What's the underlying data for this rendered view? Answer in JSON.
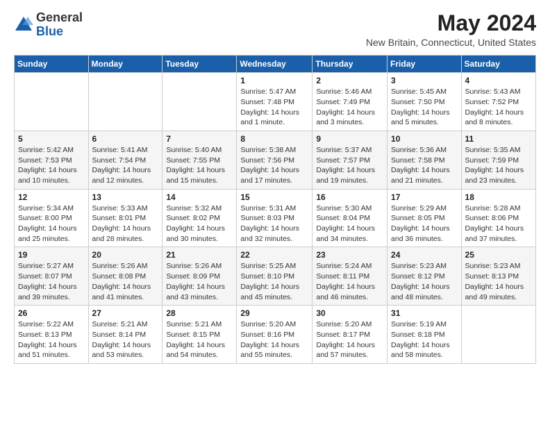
{
  "logo": {
    "general": "General",
    "blue": "Blue"
  },
  "title": {
    "month_year": "May 2024",
    "location": "New Britain, Connecticut, United States"
  },
  "weekdays": [
    "Sunday",
    "Monday",
    "Tuesday",
    "Wednesday",
    "Thursday",
    "Friday",
    "Saturday"
  ],
  "weeks": [
    [
      {
        "day": "",
        "info": ""
      },
      {
        "day": "",
        "info": ""
      },
      {
        "day": "",
        "info": ""
      },
      {
        "day": "1",
        "info": "Sunrise: 5:47 AM\nSunset: 7:48 PM\nDaylight: 14 hours\nand 1 minute."
      },
      {
        "day": "2",
        "info": "Sunrise: 5:46 AM\nSunset: 7:49 PM\nDaylight: 14 hours\nand 3 minutes."
      },
      {
        "day": "3",
        "info": "Sunrise: 5:45 AM\nSunset: 7:50 PM\nDaylight: 14 hours\nand 5 minutes."
      },
      {
        "day": "4",
        "info": "Sunrise: 5:43 AM\nSunset: 7:52 PM\nDaylight: 14 hours\nand 8 minutes."
      }
    ],
    [
      {
        "day": "5",
        "info": "Sunrise: 5:42 AM\nSunset: 7:53 PM\nDaylight: 14 hours\nand 10 minutes."
      },
      {
        "day": "6",
        "info": "Sunrise: 5:41 AM\nSunset: 7:54 PM\nDaylight: 14 hours\nand 12 minutes."
      },
      {
        "day": "7",
        "info": "Sunrise: 5:40 AM\nSunset: 7:55 PM\nDaylight: 14 hours\nand 15 minutes."
      },
      {
        "day": "8",
        "info": "Sunrise: 5:38 AM\nSunset: 7:56 PM\nDaylight: 14 hours\nand 17 minutes."
      },
      {
        "day": "9",
        "info": "Sunrise: 5:37 AM\nSunset: 7:57 PM\nDaylight: 14 hours\nand 19 minutes."
      },
      {
        "day": "10",
        "info": "Sunrise: 5:36 AM\nSunset: 7:58 PM\nDaylight: 14 hours\nand 21 minutes."
      },
      {
        "day": "11",
        "info": "Sunrise: 5:35 AM\nSunset: 7:59 PM\nDaylight: 14 hours\nand 23 minutes."
      }
    ],
    [
      {
        "day": "12",
        "info": "Sunrise: 5:34 AM\nSunset: 8:00 PM\nDaylight: 14 hours\nand 25 minutes."
      },
      {
        "day": "13",
        "info": "Sunrise: 5:33 AM\nSunset: 8:01 PM\nDaylight: 14 hours\nand 28 minutes."
      },
      {
        "day": "14",
        "info": "Sunrise: 5:32 AM\nSunset: 8:02 PM\nDaylight: 14 hours\nand 30 minutes."
      },
      {
        "day": "15",
        "info": "Sunrise: 5:31 AM\nSunset: 8:03 PM\nDaylight: 14 hours\nand 32 minutes."
      },
      {
        "day": "16",
        "info": "Sunrise: 5:30 AM\nSunset: 8:04 PM\nDaylight: 14 hours\nand 34 minutes."
      },
      {
        "day": "17",
        "info": "Sunrise: 5:29 AM\nSunset: 8:05 PM\nDaylight: 14 hours\nand 36 minutes."
      },
      {
        "day": "18",
        "info": "Sunrise: 5:28 AM\nSunset: 8:06 PM\nDaylight: 14 hours\nand 37 minutes."
      }
    ],
    [
      {
        "day": "19",
        "info": "Sunrise: 5:27 AM\nSunset: 8:07 PM\nDaylight: 14 hours\nand 39 minutes."
      },
      {
        "day": "20",
        "info": "Sunrise: 5:26 AM\nSunset: 8:08 PM\nDaylight: 14 hours\nand 41 minutes."
      },
      {
        "day": "21",
        "info": "Sunrise: 5:26 AM\nSunset: 8:09 PM\nDaylight: 14 hours\nand 43 minutes."
      },
      {
        "day": "22",
        "info": "Sunrise: 5:25 AM\nSunset: 8:10 PM\nDaylight: 14 hours\nand 45 minutes."
      },
      {
        "day": "23",
        "info": "Sunrise: 5:24 AM\nSunset: 8:11 PM\nDaylight: 14 hours\nand 46 minutes."
      },
      {
        "day": "24",
        "info": "Sunrise: 5:23 AM\nSunset: 8:12 PM\nDaylight: 14 hours\nand 48 minutes."
      },
      {
        "day": "25",
        "info": "Sunrise: 5:23 AM\nSunset: 8:13 PM\nDaylight: 14 hours\nand 49 minutes."
      }
    ],
    [
      {
        "day": "26",
        "info": "Sunrise: 5:22 AM\nSunset: 8:13 PM\nDaylight: 14 hours\nand 51 minutes."
      },
      {
        "day": "27",
        "info": "Sunrise: 5:21 AM\nSunset: 8:14 PM\nDaylight: 14 hours\nand 53 minutes."
      },
      {
        "day": "28",
        "info": "Sunrise: 5:21 AM\nSunset: 8:15 PM\nDaylight: 14 hours\nand 54 minutes."
      },
      {
        "day": "29",
        "info": "Sunrise: 5:20 AM\nSunset: 8:16 PM\nDaylight: 14 hours\nand 55 minutes."
      },
      {
        "day": "30",
        "info": "Sunrise: 5:20 AM\nSunset: 8:17 PM\nDaylight: 14 hours\nand 57 minutes."
      },
      {
        "day": "31",
        "info": "Sunrise: 5:19 AM\nSunset: 8:18 PM\nDaylight: 14 hours\nand 58 minutes."
      },
      {
        "day": "",
        "info": ""
      }
    ]
  ]
}
